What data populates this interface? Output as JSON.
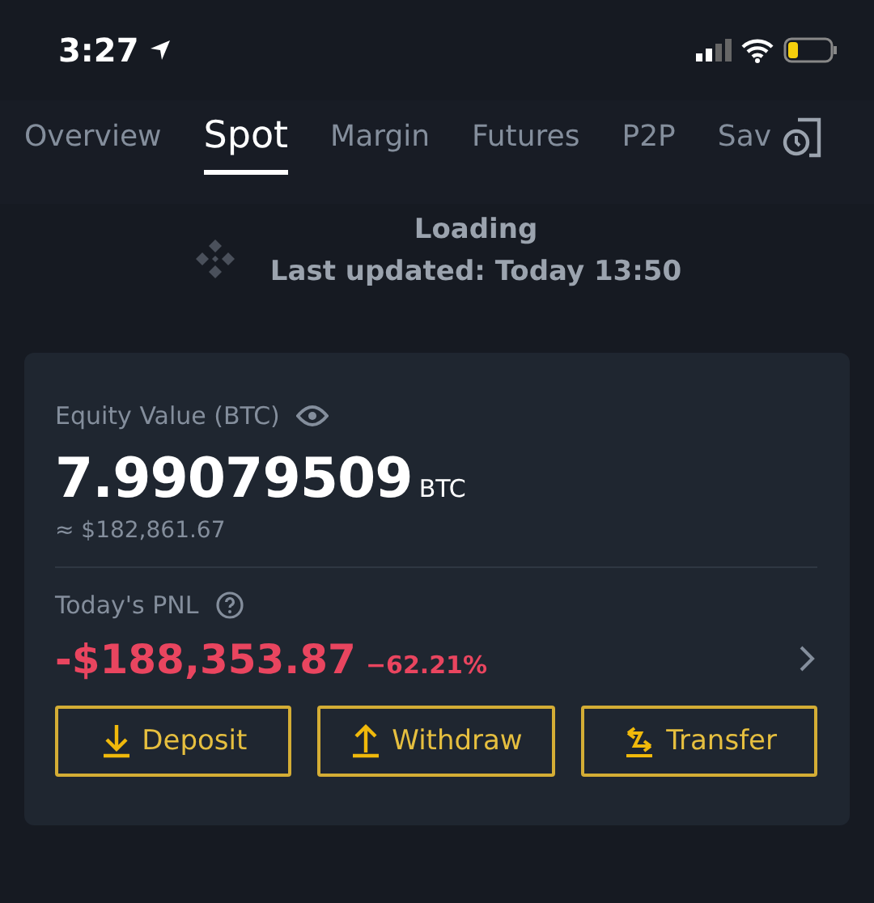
{
  "status_bar": {
    "time": "3:27"
  },
  "tabs": [
    {
      "label": "Overview",
      "selected": false
    },
    {
      "label": "Spot",
      "selected": true
    },
    {
      "label": "Margin",
      "selected": false
    },
    {
      "label": "Futures",
      "selected": false
    },
    {
      "label": "P2P",
      "selected": false
    },
    {
      "label": "Sav",
      "selected": false
    }
  ],
  "loading": {
    "title": "Loading",
    "updated": "Last updated: Today 13:50"
  },
  "equity": {
    "label": "Equity Value (BTC)",
    "value": "7.99079509",
    "unit": "BTC",
    "fiat": "≈ $182,861.67"
  },
  "pnl": {
    "label": "Today's PNL",
    "value": "-$188,353.87",
    "percent": "−62.21%"
  },
  "buttons": [
    {
      "label": "Deposit",
      "kind": "deposit"
    },
    {
      "label": "Withdraw",
      "kind": "withdraw"
    },
    {
      "label": "Transfer",
      "kind": "transfer"
    }
  ]
}
